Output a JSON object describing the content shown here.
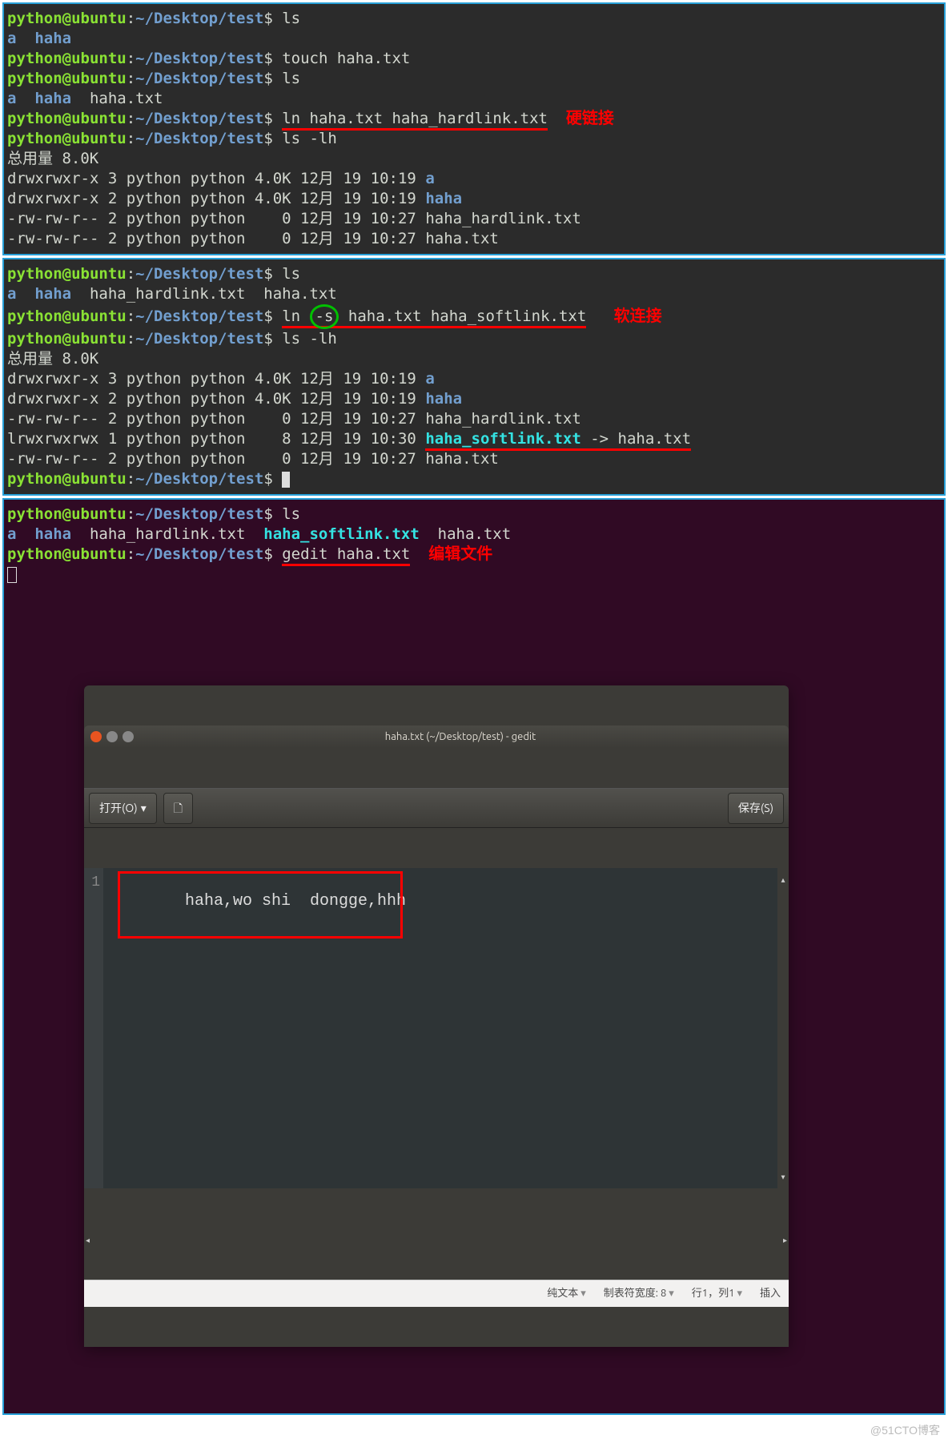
{
  "panel1": {
    "p1_user": "python@ubuntu",
    "p1_path": "~/Desktop/test",
    "p1_cmd": "ls",
    "ls1": "a  haha",
    "p2_cmd": "touch haha.txt",
    "p3_cmd": "ls",
    "ls2_dirs": "a  haha",
    "ls2_rest": "  haha.txt",
    "p4_cmd": "ln haha.txt haha_hardlink.txt",
    "annot": "硬链接",
    "p5_cmd": "ls -lh",
    "total": "总用量 8.0K",
    "r1": "drwxrwxr-x 3 python python 4.0K 12月 19 10:19 ",
    "r1d": "a",
    "r2": "drwxrwxr-x 2 python python 4.0K 12月 19 10:19 ",
    "r2d": "haha",
    "r3": "-rw-rw-r-- 2 python python    0 12月 19 10:27 haha_hardlink.txt",
    "r4": "-rw-rw-r-- 2 python python    0 12月 19 10:27 haha.txt"
  },
  "panel2": {
    "p1_cmd": "ls",
    "ls1_dirs": "a  haha",
    "ls1_rest": "  haha_hardlink.txt  haha.txt",
    "p2_cmd_pre": "ln ",
    "p2_cmd_opt": "-s",
    "p2_cmd_post": " haha.txt haha_softlink.txt",
    "annot": "软连接",
    "p3_cmd": "ls -lh",
    "total": "总用量 8.0K",
    "r1": "drwxrwxr-x 3 python python 4.0K 12月 19 10:19 ",
    "r1d": "a",
    "r2": "drwxrwxr-x 2 python python 4.0K 12月 19 10:19 ",
    "r2d": "haha",
    "r3": "-rw-rw-r-- 2 python python    0 12月 19 10:27 haha_hardlink.txt",
    "r4": "lrwxrwxrwx 1 python python    8 12月 19 10:30 ",
    "r4l": "haha_softlink.txt",
    "r4m": " -> haha.txt",
    "r5": "-rw-rw-r-- 2 python python    0 12月 19 10:27 haha.txt"
  },
  "panel3": {
    "p1_cmd": "ls",
    "ls1_dirs": "a  haha",
    "ls1_f1": "  haha_hardlink.txt  ",
    "ls1_link": "haha_softlink.txt",
    "ls1_f2": "  haha.txt",
    "p2_cmd": "gedit haha.txt",
    "annot": "编辑文件",
    "gedit": {
      "title": "haha.txt (~/Desktop/test) - gedit",
      "open": "打开(O)",
      "save": "保存(S)",
      "line_no": "1",
      "content": "haha,wo shi  dongge,hhh",
      "status_mode": "纯文本",
      "status_tab": "制表符宽度: 8",
      "status_pos": "行1，列1",
      "status_ins": "插入"
    }
  },
  "user": "python@ubuntu",
  "path": "~/Desktop/test",
  "dollar": "$ ",
  "watermark": "@51CTO博客"
}
